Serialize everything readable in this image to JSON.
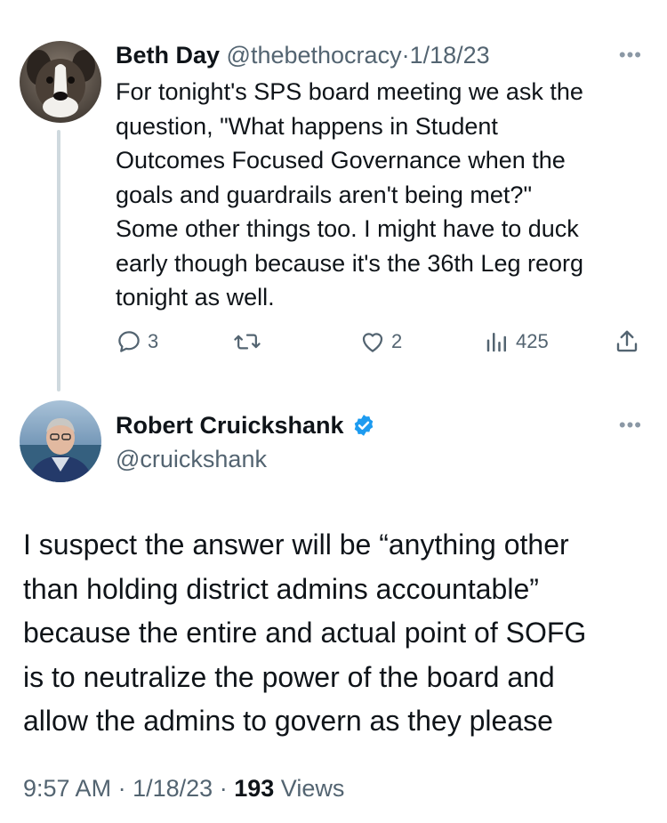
{
  "parent_tweet": {
    "name": "Beth Day",
    "handle": "@thebethocracy",
    "separator": "·",
    "date": "1/18/23",
    "more_icon": "ellipsis-icon",
    "lines": [
      "For tonight's SPS board meeting we ask the",
      "question, \"What happens in Student",
      "Outcomes Focused Governance when the",
      "goals and guardrails aren't being met?\"",
      "Some other things too. I might have to duck",
      "early though because it's the 36th Leg reorg",
      "tonight as well."
    ],
    "actions": {
      "replies": "3",
      "retweets": "",
      "likes": "2",
      "views": "425"
    }
  },
  "reply_tweet": {
    "name": "Robert Cruickshank",
    "verified": true,
    "handle": "@cruickshank",
    "more_icon": "ellipsis-icon",
    "lines": [
      "I suspect the answer will be “anything other",
      "than holding district admins accountable”",
      "because the entire and actual point of SOFG",
      "is to neutralize the power of the board and",
      "allow the admins to govern as they please"
    ],
    "time": "9:57 AM",
    "separator": "·",
    "date": "1/18/23",
    "views_count": "193",
    "views_label": "Views"
  },
  "colors": {
    "text": "#0f1419",
    "muted": "#536471",
    "verified": "#1d9bf0",
    "thread_line": "#cfd9de"
  }
}
